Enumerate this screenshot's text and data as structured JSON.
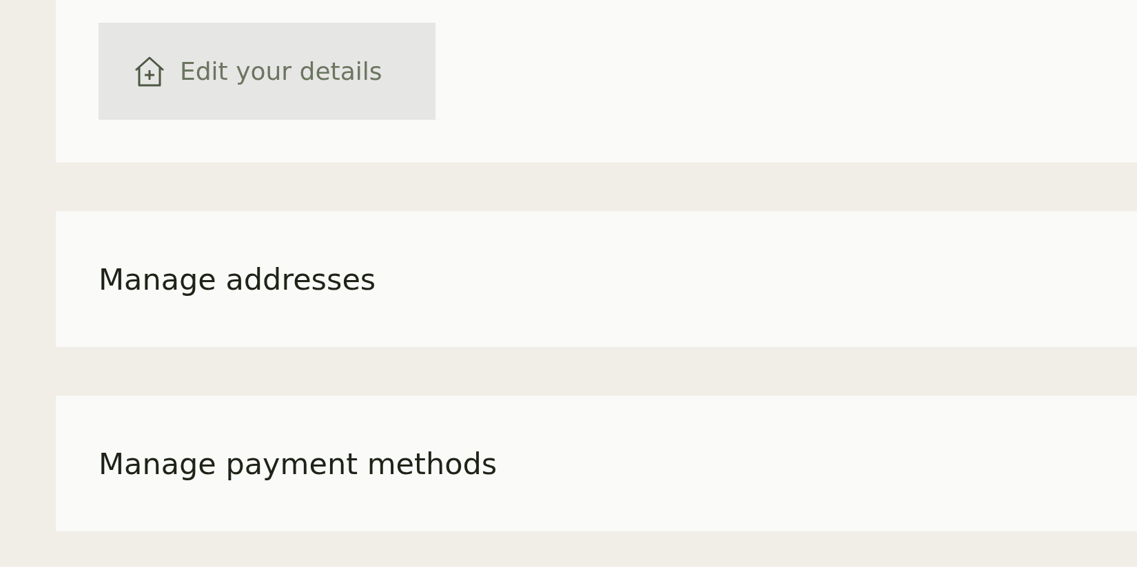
{
  "edit_button": {
    "label": "Edit your details"
  },
  "sections": [
    {
      "title": "Manage addresses"
    },
    {
      "title": "Manage payment methods"
    }
  ]
}
